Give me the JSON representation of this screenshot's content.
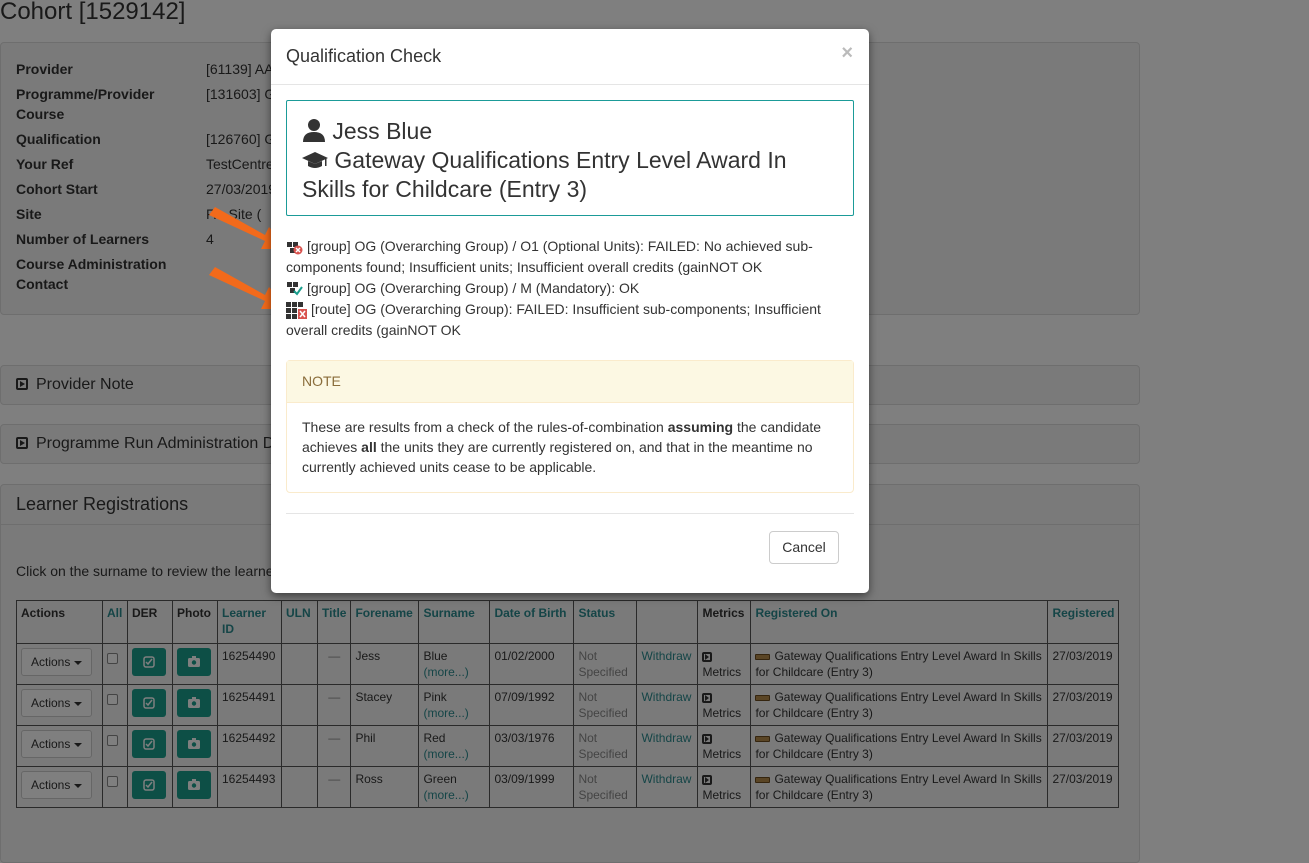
{
  "page": {
    "title": "Cohort [1529142]"
  },
  "info": [
    {
      "label": "Provider",
      "value": "[61139] AA"
    },
    {
      "label": "Programme/Provider Course",
      "value": "[131603] G"
    },
    {
      "label": "Qualification",
      "value": "[126760] G"
    },
    {
      "label": "Your Ref",
      "value": "TestCentre"
    },
    {
      "label": "Cohort Start",
      "value": "27/03/2019"
    },
    {
      "label": "Site",
      "value": "F... Site ("
    },
    {
      "label": "Number of Learners",
      "value": "4"
    },
    {
      "label": "Course Administration Contact",
      "value": ""
    }
  ],
  "sections": {
    "provider_note": "Provider Note",
    "programme_run": "Programme Run Administration D",
    "learner_registrations": "Learner Registrations",
    "hint": "Click on the surname to review the learne"
  },
  "table": {
    "headers": [
      "Actions",
      "All",
      "DER",
      "Photo",
      "Learner ID",
      "ULN",
      "Title",
      "Forename",
      "Surname",
      "Date of Birth",
      "Status",
      "",
      "Metrics",
      "Registered On",
      "Registered"
    ],
    "actions_label": "Actions",
    "more_label": "(more...)",
    "withdraw_label": "Withdraw",
    "metrics_label": "Metrics",
    "title_placeholder": "—",
    "rows": [
      {
        "learner_id": "16254490",
        "forename": "Jess",
        "surname": "Blue",
        "dob": "01/02/2000",
        "status": "Not Specified",
        "registered_on": "Gateway Qualifications Entry Level Award In Skills for Childcare (Entry 3)",
        "registered": "27/03/2019"
      },
      {
        "learner_id": "16254491",
        "forename": "Stacey",
        "surname": "Pink",
        "dob": "07/09/1992",
        "status": "Not Specified",
        "registered_on": "Gateway Qualifications Entry Level Award In Skills for Childcare (Entry 3)",
        "registered": "27/03/2019"
      },
      {
        "learner_id": "16254492",
        "forename": "Phil",
        "surname": "Red",
        "dob": "03/03/1976",
        "status": "Not Specified",
        "registered_on": "Gateway Qualifications Entry Level Award In Skills for Childcare (Entry 3)",
        "registered": "27/03/2019"
      },
      {
        "learner_id": "16254493",
        "forename": "Ross",
        "surname": "Green",
        "dob": "03/09/1999",
        "status": "Not Specified",
        "registered_on": "Gateway Qualifications Entry Level Award In Skills for Childcare (Entry 3)",
        "registered": "27/03/2019"
      }
    ]
  },
  "modal": {
    "title": "Qualification Check",
    "close": "×",
    "learner_name": "Jess Blue",
    "qualification": "Gateway Qualifications Entry Level Award In Skills for Childcare (Entry 3)",
    "results": [
      {
        "icon": "group-failed-icon",
        "text": "[group] OG (Overarching Group) / O1 (Optional Units): FAILED: No achieved sub-components found; Insufficient units; Insufficient overall credits (gainNOT OK"
      },
      {
        "icon": "group-ok-icon",
        "text": "[group] OG (Overarching Group) / M (Mandatory): OK"
      },
      {
        "icon": "route-failed-icon",
        "text": "[route] OG (Overarching Group): FAILED: Insufficient sub-components; Insufficient overall credits (gainNOT OK"
      }
    ],
    "note_heading": "NOTE",
    "note_part1": "These are results from a check of the rules-of-combination ",
    "note_bold1": "assuming",
    "note_part2": " the candidate achieves ",
    "note_bold2": "all",
    "note_part3": " the units they are currently registered on, and that in the meantime no currently achieved units cease to be applicable.",
    "cancel": "Cancel"
  },
  "colors": {
    "accent": "#1a9e8d",
    "link": "#2a8a8e",
    "arrow": "#f26a1b",
    "note_bg": "#fcf8e3"
  }
}
